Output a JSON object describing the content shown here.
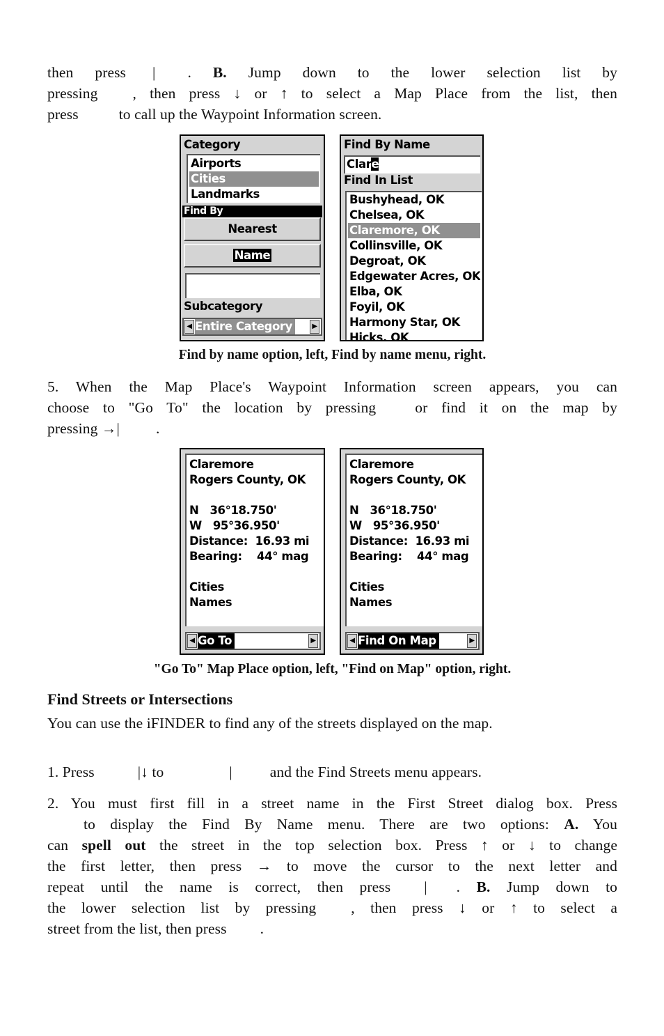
{
  "paragraph_top": {
    "lines": [
      {
        "segments": [
          "then press",
          "|",
          ".",
          "B.",
          "Jump down to the lower selection list by"
        ]
      },
      {
        "segments": [
          "pressing",
          ", then press ↓ or ↑ to select a Map Place from the list, then"
        ]
      },
      {
        "segments": [
          "press",
          "to call up the Waypoint Information screen."
        ]
      }
    ]
  },
  "screen_category": {
    "category_label": "Category",
    "categories": [
      "Airports",
      "Cities",
      "Landmarks"
    ],
    "selected_category": "Cities",
    "find_by_label": "Find By",
    "nearest_button": "Nearest",
    "name_button": "Name",
    "subcategory_label": "Subcategory",
    "subcategory_value": "Entire Category"
  },
  "screen_find_by_name": {
    "find_by_name_label": "Find By Name",
    "input_text": "Clar",
    "input_cursor_char": "e",
    "find_in_list_label": "Find In List",
    "results": [
      "Bushyhead, OK",
      "Chelsea, OK",
      "Claremore, OK",
      "Collinsville, OK",
      "Degroat, OK",
      "Edgewater Acres, OK",
      "Elba, OK",
      "Foyil, OK",
      "Harmony Star, OK",
      "Hicks, OK"
    ],
    "selected_result": "Claremore, OK"
  },
  "caption_1": "Find by name option, left, Find by name menu, right.",
  "paragraph_5": {
    "lines": [
      {
        "segments": [
          "5. When the Map Place's Waypoint Information screen appears, you can"
        ]
      },
      {
        "segments": [
          "choose to \"Go To\" the location by pressing",
          "or find it on the map by"
        ]
      },
      {
        "segments": [
          "pressing →|",
          "."
        ]
      }
    ]
  },
  "screen_goto": {
    "name": "Claremore",
    "county": "Rogers County, OK",
    "lat": "N   36°18.750'",
    "lon": "W   95°36.950'",
    "distance": "Distance:  16.93 mi",
    "bearing": "Bearing:    44° mag",
    "category": "Cities",
    "subcategory": "Names",
    "action": "Go To"
  },
  "screen_findonmap": {
    "name": "Claremore",
    "county": "Rogers County, OK",
    "lat": "N   36°18.750'",
    "lon": "W   95°36.950'",
    "distance": "Distance:  16.93 mi",
    "bearing": "Bearing:    44° mag",
    "category": "Cities",
    "subcategory": "Names",
    "action": "Find On Map"
  },
  "caption_2": "\"Go To\" Map Place option, left, \"Find on Map\" option, right.",
  "section": {
    "heading": "Find Streets or Intersections",
    "intro": "You can use the iFINDER to find any of the streets displayed on the map."
  },
  "step_1": {
    "segments": [
      "1. Press",
      "|↓ to",
      "|",
      "and the Find Streets menu appears."
    ]
  },
  "step_2": {
    "lines": [
      {
        "segments": [
          "2. You must first fill in a street name in the First Street dialog box. Press"
        ]
      },
      {
        "segments": [
          "to display the Find By Name menu. There are two options:",
          "A.",
          "You"
        ]
      },
      {
        "segments": [
          "can",
          "spell out",
          "the street in the top selection box. Press ↑ or ↓ to change"
        ]
      },
      {
        "segments": [
          "the first letter, then press → to move the cursor to the next letter and"
        ]
      },
      {
        "segments": [
          "repeat until the name is correct, then press",
          "|",
          ".",
          "B.",
          "Jump down to"
        ]
      },
      {
        "segments": [
          "the lower selection list by pressing",
          ", then press ↓ or ↑ to select a"
        ]
      },
      {
        "segments": [
          "street from the list, then press",
          "."
        ]
      }
    ]
  }
}
